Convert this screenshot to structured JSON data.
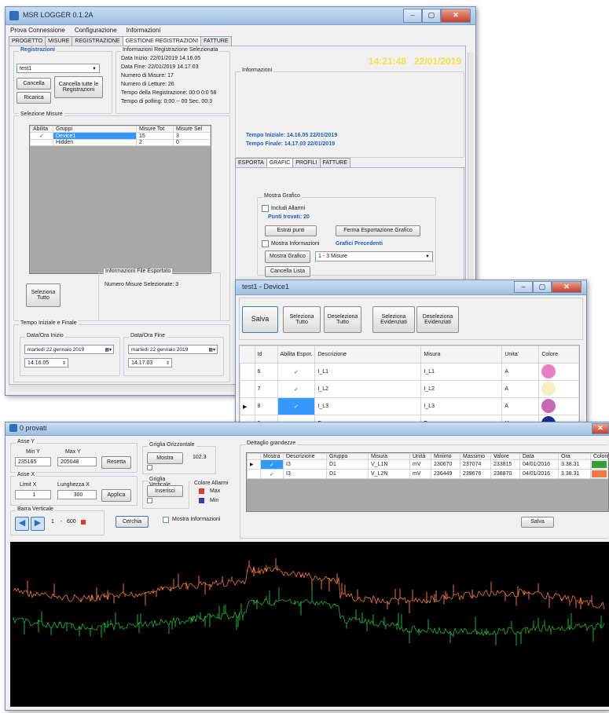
{
  "win1": {
    "title": "MSR LOGGER 0.1.2A",
    "menu": [
      "Prova Connessione",
      "Configurazione",
      "Informazioni"
    ],
    "tabs": [
      "PROGETTO",
      "MISURE",
      "REGISTRAZIONE",
      "GESTIONE REGISTRAZIONI",
      "FATTURE"
    ],
    "registrazioni": {
      "label": "Registrazioni",
      "selected": "test1",
      "cancella": "Cancella",
      "cancella_tutte": "Cancella tutte le Registrazioni",
      "ricarica": "Ricarica"
    },
    "info_reg": {
      "label": "Informazioni Registrazione Selezionata",
      "lines": [
        "Data Inizio: 22/01/2019 14.16.05",
        "Data Fine: 22/01/2019 14.17.03",
        "Numero di Misure: 17",
        "Numero di Letture: 26",
        "Tempo della Registrazione: 00:0 0:0 58",
        "Tempo di polling: 0:00 -- 00 Sec. 00:3"
      ]
    },
    "clock": {
      "time": "14:21:48",
      "date": "22/01/2019"
    },
    "informazioni_label": "Informazioni",
    "selezione_misure": {
      "label": "Selezione Misure",
      "headers": [
        "Abilita",
        "Gruppi",
        "Misure Tot",
        "Misure Sel"
      ],
      "rows": [
        {
          "name": "Device1",
          "tot": "15",
          "sel": "3",
          "checked": "✓"
        },
        {
          "name": "Hidden",
          "tot": "2",
          "sel": "0",
          "checked": ""
        }
      ]
    },
    "seleziona_tutto": "Seleziona Tutto",
    "info_file": {
      "label": "Informazioni File Esportato",
      "text": "Numero Misure Selezionate: 3"
    },
    "tempo": {
      "label": "Tempo Iniziale e Finale",
      "inizio_label": "Data/Ora Inizio",
      "inizio_date": "martedì 22 gennaio 2019",
      "inizio_time": "14.16.05",
      "fine_label": "Data/Ora Fine",
      "fine_date": "martedì 22 gennaio 2019",
      "fine_time": "14.17.03"
    },
    "tempo_iniziale": "Tempo Iniziale: 14.16.05 22/01/2019",
    "tempo_finale": "Tempo Finale: 14.17.03 22/01/2019",
    "subtabs": [
      "ESPORTA",
      "GRAFIC",
      "PROFILI",
      "FATTURE"
    ],
    "mostra_grafico": {
      "label": "Mostra Grafico",
      "includi_allarmi": "Includi Allarmi",
      "punti_trovati": "Punti trovati: 20",
      "estrai_punti": "Estrai punti",
      "ferma": "Ferma Esportazione Grafico",
      "mostra_info": "Mostra Informazioni",
      "grafici_precedenti": "Grafici Precedenti",
      "mostra_btn": "Mostra Grafico",
      "select": "1 - 3 Misure",
      "cancella_lista": "Cancella Lista"
    }
  },
  "win2": {
    "title": "test1 - Device1",
    "toolbar": [
      "Salva",
      "Seleziona Tutto",
      "Deseleziona Tutto",
      "Seleziona Evidenziati",
      "Deseleziona Evidenziati"
    ],
    "headers": [
      "Id",
      "Abilita Espor.",
      "Descrizione",
      "Misura",
      "Unita'",
      "Colore"
    ],
    "rows": [
      {
        "id": "6",
        "chk": "✓",
        "desc": "I_L1",
        "misura": "I_L1",
        "unit": "A",
        "color": "#e77fc4"
      },
      {
        "id": "7",
        "chk": "✓",
        "desc": "I_L2",
        "misura": "I_L2",
        "unit": "A",
        "color": "#f6efc4"
      },
      {
        "id": "8",
        "chk": "✓",
        "desc": "I_L3",
        "misura": "I_L3",
        "unit": "A",
        "color": "#c869b4"
      },
      {
        "id": "9",
        "chk": "",
        "desc": "F",
        "misura": "F",
        "unit": "Hz",
        "color": "#1d2c8e"
      }
    ]
  },
  "win3": {
    "title": "0 provati",
    "asse_y": {
      "label": "Asse Y",
      "min_label": "Min Y",
      "max_label": "Max Y",
      "min": "235165",
      "max": "205048",
      "reset": "Resetta"
    },
    "asse_x": {
      "label": "Asse X",
      "limit_label": "Limit X",
      "length_label": "Lunghezza X",
      "limit": "1",
      "length": "300",
      "applica": "Applica"
    },
    "griglia_orizzontale": {
      "label": "Griglia Orizzontale",
      "btn": "Mostra",
      "value": "102.3"
    },
    "griglia_verticale": {
      "label": "Griglia Verticale",
      "btn": "Inserisci"
    },
    "colore_allarmi": {
      "label": "Colore Allarmi",
      "max": "Max",
      "min": "Min",
      "max_color": "#e03a2a",
      "min_color": "#3d3da8"
    },
    "barra": {
      "label": "Barra Verticale",
      "value": "1",
      "sep": "-",
      "max": "600"
    },
    "cerchia": "Cerchia",
    "mostra_info": "Mostra Informazioni",
    "dettaglio": {
      "label": "Dettaglio grandezze",
      "headers": [
        "Mostra",
        "Descrizione",
        "Gruppo",
        "Misura",
        "Unità",
        "Minimo",
        "Massimo",
        "Valore",
        "Data",
        "Ora",
        "Colore"
      ],
      "rows": [
        {
          "desc": "I3",
          "gruppo": "D1",
          "misura": "V_L1N",
          "unita": "mV",
          "minimo": "230670",
          "massimo": "237074",
          "valore": "233815",
          "data": "04/01/2016",
          "ora": "3.38.31",
          "color": "#33a033"
        },
        {
          "desc": "I3",
          "gruppo": "D1",
          "misura": "V_L2N",
          "unita": "mV",
          "minimo": "236449",
          "massimo": "239676",
          "valore": "238870",
          "data": "04/01/2016",
          "ora": "3.38.31",
          "color": "#f07844"
        }
      ],
      "salva": "Salva"
    },
    "series_colors": [
      "#f07844",
      "#22b03a"
    ]
  }
}
